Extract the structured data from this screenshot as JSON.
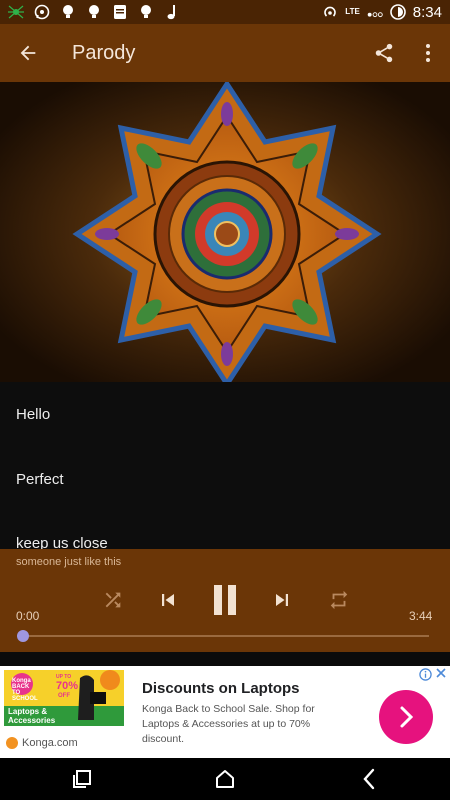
{
  "status_bar": {
    "time": "8:34",
    "network_label": "LTE",
    "icons": [
      "spider-icon",
      "whatsapp-icon",
      "bulb-icon",
      "bulb-icon",
      "note-icon",
      "bulb-icon",
      "music-note-icon",
      "hotspot-icon",
      "signal-icon",
      "battery-icon"
    ]
  },
  "app_bar": {
    "title": "Parody",
    "icons": [
      "back-arrow-icon",
      "share-icon",
      "more-vert-icon"
    ]
  },
  "lyrics": {
    "lines": [
      "Hello",
      "Perfect",
      "keep us close"
    ]
  },
  "player": {
    "now_line": "someone just like this",
    "elapsed": "0:00",
    "duration": "3:44",
    "progress": 0.0,
    "icons": [
      "shuffle-icon",
      "previous-icon",
      "pause-icon",
      "next-icon",
      "repeat-icon"
    ],
    "accent": "#9f97df"
  },
  "ad": {
    "title": "Discounts on Laptops",
    "description": "Konga Back to School Sale. Shop for Laptops & Accessories at up to 70% discount.",
    "brand": "Konga.com",
    "image_texts": {
      "badge": "Konga BACK TO SCHOOL",
      "offer_top": "UP TO",
      "offer_pct": "70%",
      "offer_bottom": "OFF",
      "caption_1": "Laptops &",
      "caption_2": "Accessories"
    },
    "cta_color": "#e6127e"
  },
  "colors": {
    "app_bar": "#6b3607",
    "status_bar": "#4a2404",
    "player": "#6b3607",
    "lyrics_bg": "#0d0d0d"
  }
}
